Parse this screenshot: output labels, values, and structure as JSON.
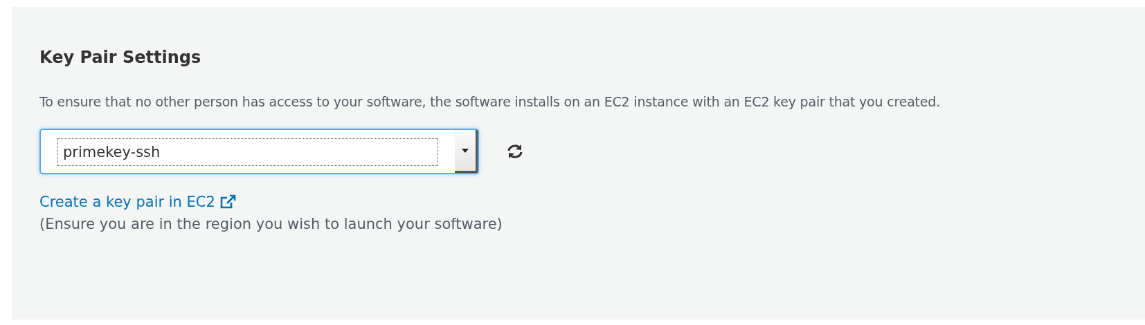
{
  "panel": {
    "title": "Key Pair Settings",
    "description": "To ensure that no other person has access to your software, the software installs on an EC2 instance with an EC2 key pair that you created.",
    "key_pair_select": {
      "value": "primekey-ssh",
      "focused": true
    },
    "link": "Create a key pair in EC2",
    "note": "(Ensure you are in the region you wish to launch your software)"
  }
}
